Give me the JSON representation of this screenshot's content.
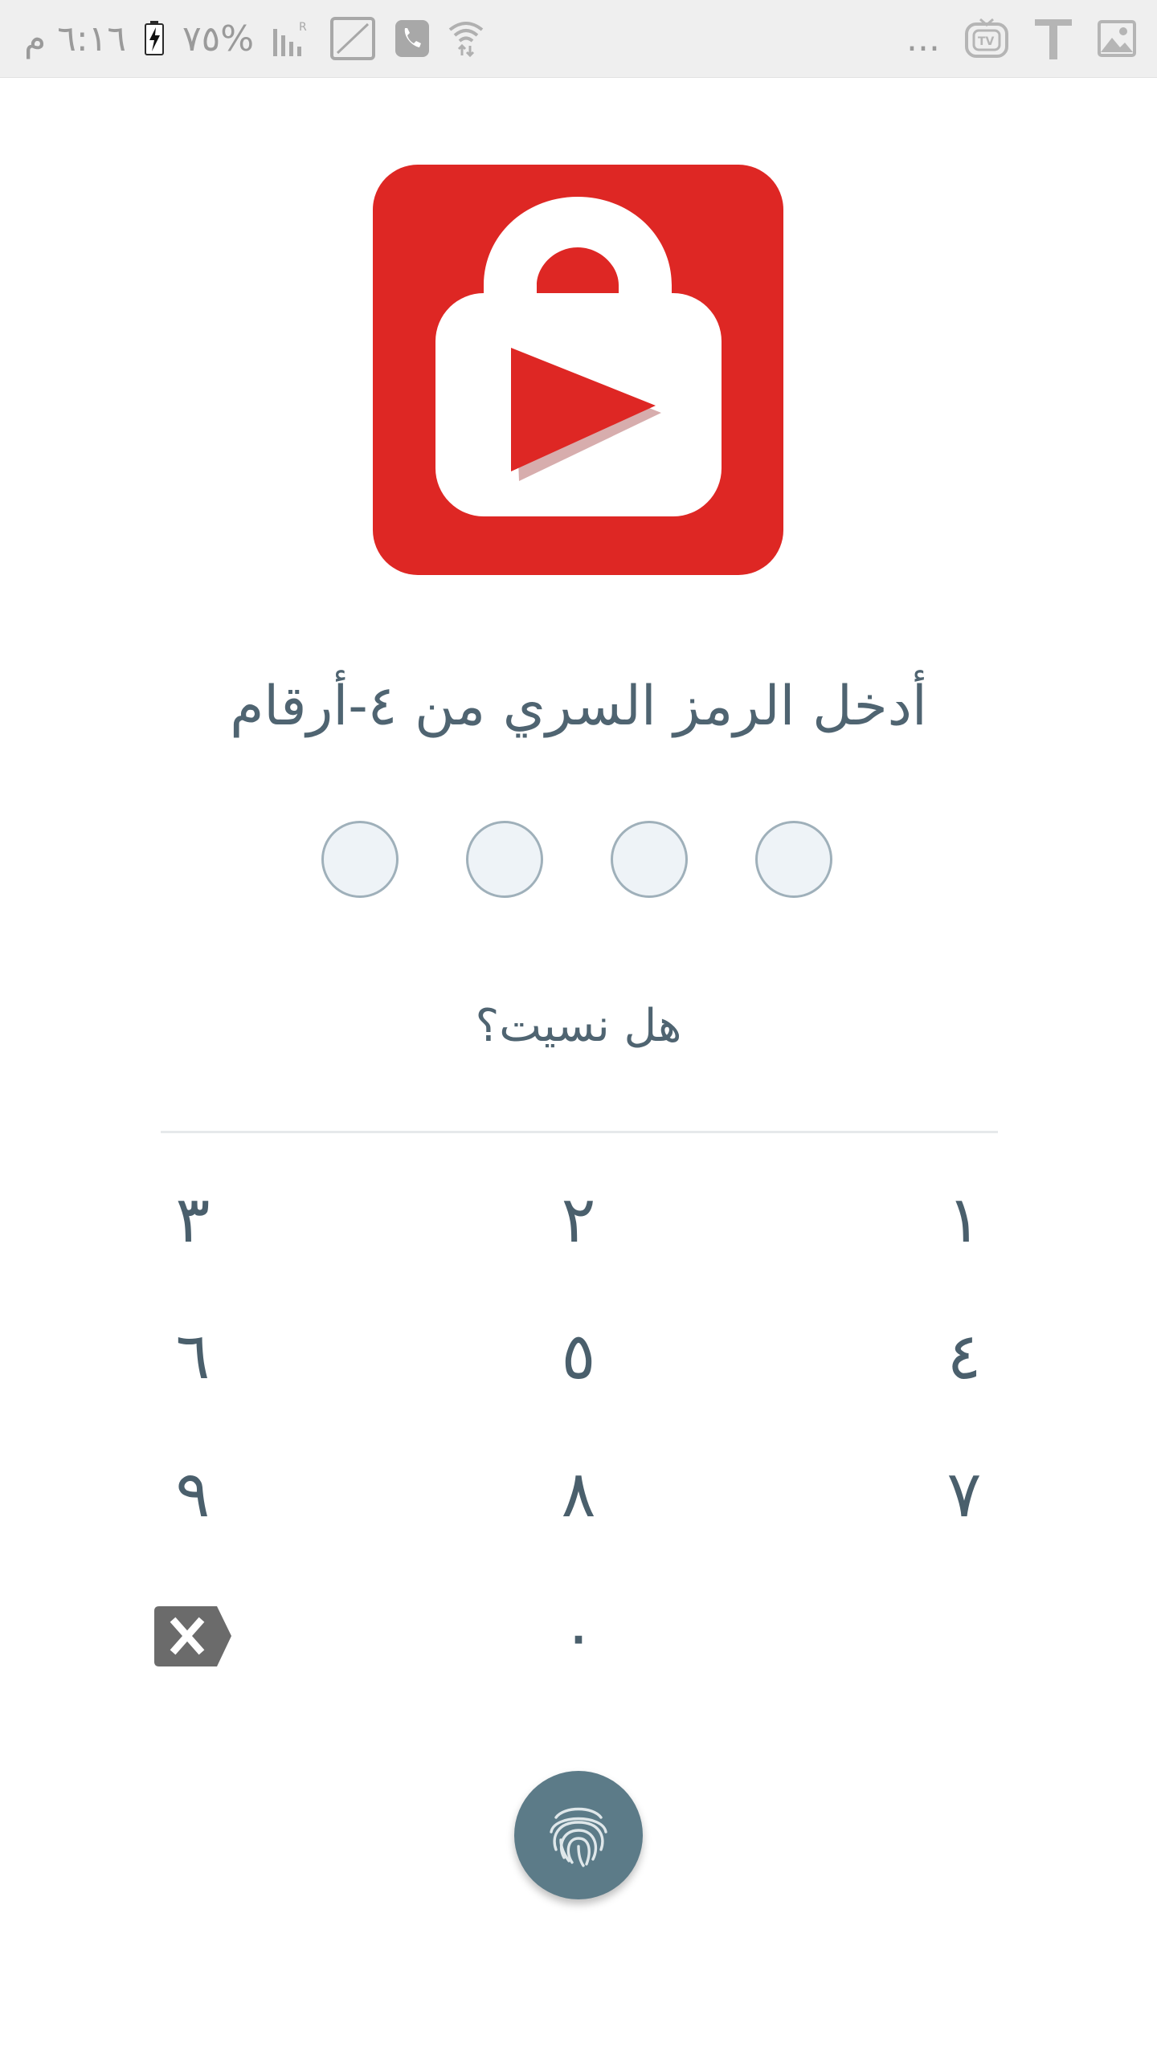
{
  "status_bar": {
    "time": "٦:١٦ م",
    "battery": "%٧٥",
    "overflow": "...",
    "icons_left": [
      "charging-battery-icon",
      "signal-icon",
      "no-sim-icon",
      "call-icon",
      "wifi-icon"
    ],
    "icons_right": [
      "overflow-dots-icon",
      "tv-icon",
      "text-icon",
      "image-icon"
    ]
  },
  "app": {
    "logo_icon": "lock-play-icon",
    "brand_color": "#de2724"
  },
  "pin": {
    "prompt": "أدخل الرمز السري من ٤-أرقام",
    "dot_count": 4,
    "forgot_label": "هل نسيت؟"
  },
  "keypad": {
    "keys": [
      "١",
      "٢",
      "٣",
      "٤",
      "٥",
      "٦",
      "٧",
      "٨",
      "٩",
      "٠"
    ],
    "backspace_icon": "backspace-icon",
    "fingerprint_icon": "fingerprint-icon",
    "fingerprint_color": "#5c7b88"
  }
}
